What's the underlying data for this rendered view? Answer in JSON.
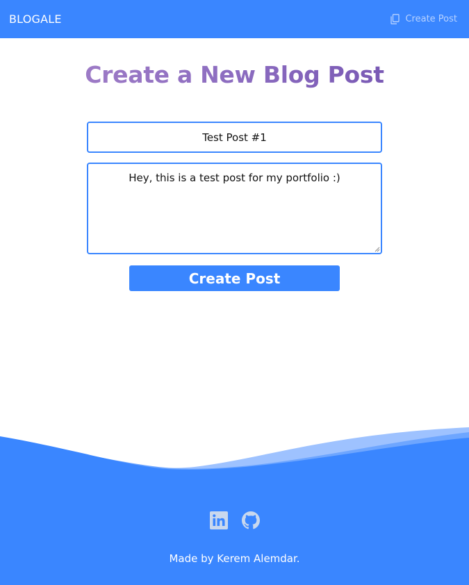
{
  "navbar": {
    "brand": "BLOGALE",
    "create_link": "Create Post",
    "create_icon": "copy-icon"
  },
  "main": {
    "title": "Create a New Blog Post",
    "title_gradient": [
      "#a682c9",
      "#6f4fae"
    ],
    "post_title_value": "Test Post #1",
    "post_content_value": "Hey, this is a test post for my portfolio :)",
    "submit_label": "Create Post"
  },
  "footer": {
    "icons": [
      "linkedin-icon",
      "github-icon"
    ],
    "credit": "Made by Kerem Alemdar."
  },
  "colors": {
    "primary": "#3a86ff",
    "nav_link": "#b8d2ff",
    "social_icon": "#b9cbe6"
  }
}
